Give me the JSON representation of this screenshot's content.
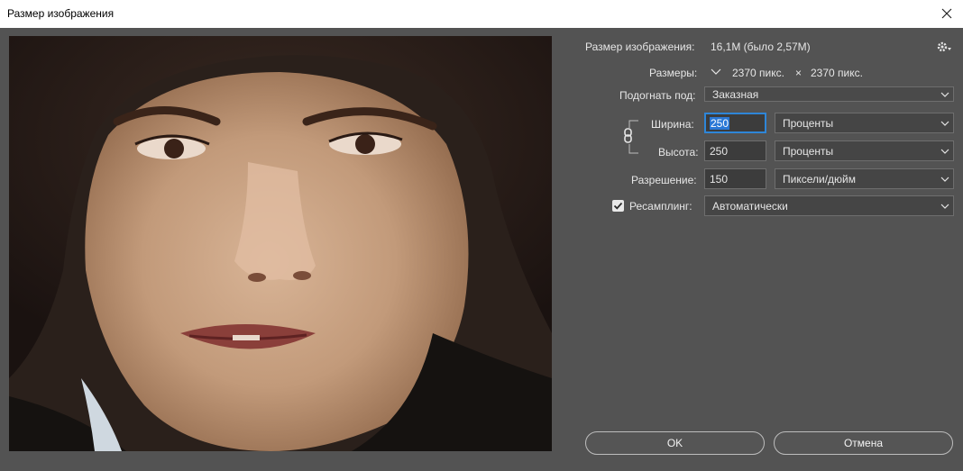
{
  "dialog": {
    "title": "Размер изображения"
  },
  "info": {
    "image_size_label": "Размер изображения:",
    "image_size_value": "16,1M (было 2,57M)",
    "dimensions_label": "Размеры:",
    "dimensions_width": "2370 пикс.",
    "dimensions_x": "×",
    "dimensions_height": "2370 пикс."
  },
  "fit": {
    "label": "Подогнать под:",
    "value": "Заказная"
  },
  "width": {
    "label": "Ширина:",
    "value": "250",
    "unit": "Проценты"
  },
  "height": {
    "label": "Высота:",
    "value": "250",
    "unit": "Проценты"
  },
  "resolution": {
    "label": "Разрешение:",
    "value": "150",
    "unit": "Пиксели/дюйм"
  },
  "resample": {
    "label": "Ресамплинг:",
    "checked": true,
    "value": "Автоматически"
  },
  "buttons": {
    "ok": "OK",
    "cancel": "Отмена"
  },
  "colors": {
    "background": "#535353",
    "field": "#3c3c3c",
    "focus": "#2e86d8"
  },
  "icons": {
    "close": "close-icon",
    "settings": "gear-icon",
    "chain": "link-chain-icon",
    "chevron": "chevron-down-icon",
    "check": "checkmark-icon"
  }
}
